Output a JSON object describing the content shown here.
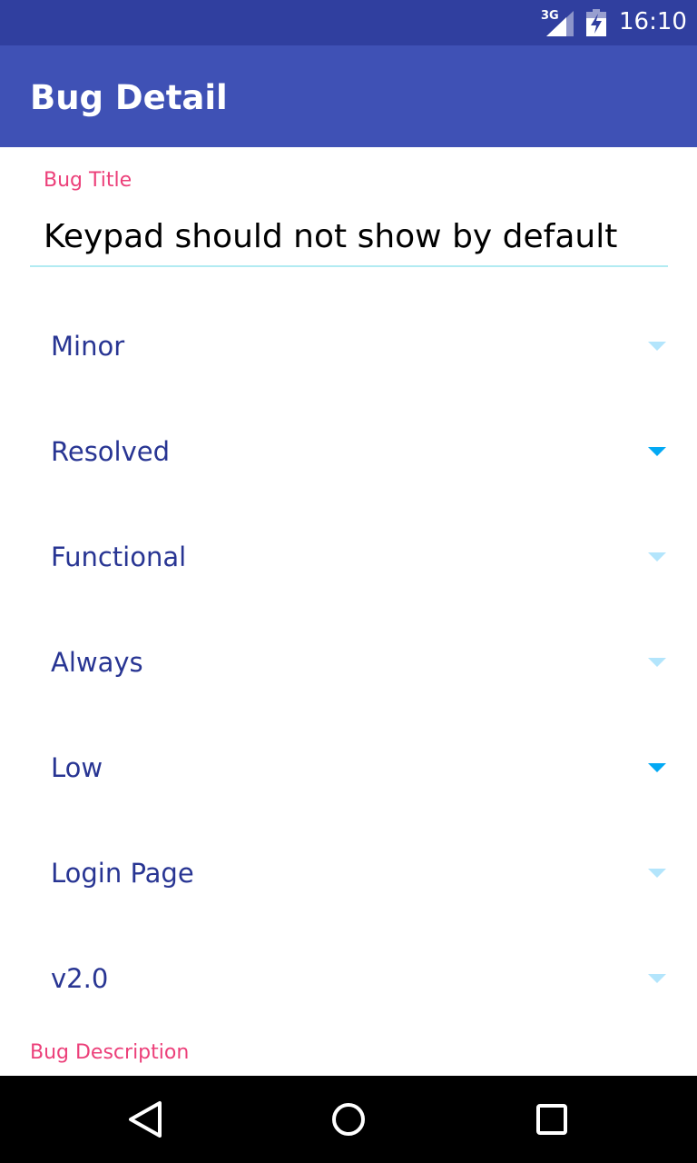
{
  "status_bar": {
    "network": "3G",
    "signal_icon": "signal-icon",
    "battery_icon": "battery-charging-icon",
    "time": "16:10",
    "background": "#303f9f"
  },
  "app_bar": {
    "title": "Bug Detail",
    "background": "#3f51b5"
  },
  "form": {
    "bug_title_label": "Bug Title",
    "bug_title_value": "Keypad should not show by default",
    "spinners": [
      {
        "value": "Minor",
        "arrow": "dropdown-arrow-icon"
      },
      {
        "value": "Resolved",
        "arrow": "dropdown-arrow-icon"
      },
      {
        "value": "Functional",
        "arrow": "dropdown-arrow-icon"
      },
      {
        "value": "Always",
        "arrow": "dropdown-arrow-icon"
      },
      {
        "value": "Low",
        "arrow": "dropdown-arrow-icon"
      },
      {
        "value": "Login Page",
        "arrow": "dropdown-arrow-icon"
      },
      {
        "value": "v2.0",
        "arrow": "dropdown-arrow-icon"
      }
    ],
    "bug_description_label": "Bug Description"
  },
  "colors": {
    "label_accent": "#ec407a",
    "spinner_text": "#283593",
    "arrow_dim": "#b3e5fc",
    "arrow_active": "#03a9f4",
    "input_underline": "#b2ebf2"
  },
  "nav_bar": {
    "back_icon": "back-triangle-icon",
    "home_icon": "home-circle-icon",
    "recents_icon": "recents-square-icon"
  }
}
